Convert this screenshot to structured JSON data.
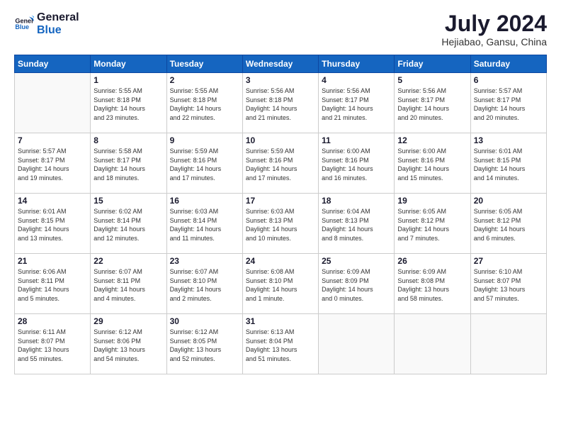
{
  "logo": {
    "line1": "General",
    "line2": "Blue"
  },
  "title": "July 2024",
  "subtitle": "Hejiabao, Gansu, China",
  "weekdays": [
    "Sunday",
    "Monday",
    "Tuesday",
    "Wednesday",
    "Thursday",
    "Friday",
    "Saturday"
  ],
  "weeks": [
    [
      {
        "day": "",
        "info": ""
      },
      {
        "day": "1",
        "info": "Sunrise: 5:55 AM\nSunset: 8:18 PM\nDaylight: 14 hours\nand 23 minutes."
      },
      {
        "day": "2",
        "info": "Sunrise: 5:55 AM\nSunset: 8:18 PM\nDaylight: 14 hours\nand 22 minutes."
      },
      {
        "day": "3",
        "info": "Sunrise: 5:56 AM\nSunset: 8:18 PM\nDaylight: 14 hours\nand 21 minutes."
      },
      {
        "day": "4",
        "info": "Sunrise: 5:56 AM\nSunset: 8:17 PM\nDaylight: 14 hours\nand 21 minutes."
      },
      {
        "day": "5",
        "info": "Sunrise: 5:56 AM\nSunset: 8:17 PM\nDaylight: 14 hours\nand 20 minutes."
      },
      {
        "day": "6",
        "info": "Sunrise: 5:57 AM\nSunset: 8:17 PM\nDaylight: 14 hours\nand 20 minutes."
      }
    ],
    [
      {
        "day": "7",
        "info": "Sunrise: 5:57 AM\nSunset: 8:17 PM\nDaylight: 14 hours\nand 19 minutes."
      },
      {
        "day": "8",
        "info": "Sunrise: 5:58 AM\nSunset: 8:17 PM\nDaylight: 14 hours\nand 18 minutes."
      },
      {
        "day": "9",
        "info": "Sunrise: 5:59 AM\nSunset: 8:16 PM\nDaylight: 14 hours\nand 17 minutes."
      },
      {
        "day": "10",
        "info": "Sunrise: 5:59 AM\nSunset: 8:16 PM\nDaylight: 14 hours\nand 17 minutes."
      },
      {
        "day": "11",
        "info": "Sunrise: 6:00 AM\nSunset: 8:16 PM\nDaylight: 14 hours\nand 16 minutes."
      },
      {
        "day": "12",
        "info": "Sunrise: 6:00 AM\nSunset: 8:16 PM\nDaylight: 14 hours\nand 15 minutes."
      },
      {
        "day": "13",
        "info": "Sunrise: 6:01 AM\nSunset: 8:15 PM\nDaylight: 14 hours\nand 14 minutes."
      }
    ],
    [
      {
        "day": "14",
        "info": "Sunrise: 6:01 AM\nSunset: 8:15 PM\nDaylight: 14 hours\nand 13 minutes."
      },
      {
        "day": "15",
        "info": "Sunrise: 6:02 AM\nSunset: 8:14 PM\nDaylight: 14 hours\nand 12 minutes."
      },
      {
        "day": "16",
        "info": "Sunrise: 6:03 AM\nSunset: 8:14 PM\nDaylight: 14 hours\nand 11 minutes."
      },
      {
        "day": "17",
        "info": "Sunrise: 6:03 AM\nSunset: 8:13 PM\nDaylight: 14 hours\nand 10 minutes."
      },
      {
        "day": "18",
        "info": "Sunrise: 6:04 AM\nSunset: 8:13 PM\nDaylight: 14 hours\nand 8 minutes."
      },
      {
        "day": "19",
        "info": "Sunrise: 6:05 AM\nSunset: 8:12 PM\nDaylight: 14 hours\nand 7 minutes."
      },
      {
        "day": "20",
        "info": "Sunrise: 6:05 AM\nSunset: 8:12 PM\nDaylight: 14 hours\nand 6 minutes."
      }
    ],
    [
      {
        "day": "21",
        "info": "Sunrise: 6:06 AM\nSunset: 8:11 PM\nDaylight: 14 hours\nand 5 minutes."
      },
      {
        "day": "22",
        "info": "Sunrise: 6:07 AM\nSunset: 8:11 PM\nDaylight: 14 hours\nand 4 minutes."
      },
      {
        "day": "23",
        "info": "Sunrise: 6:07 AM\nSunset: 8:10 PM\nDaylight: 14 hours\nand 2 minutes."
      },
      {
        "day": "24",
        "info": "Sunrise: 6:08 AM\nSunset: 8:10 PM\nDaylight: 14 hours\nand 1 minute."
      },
      {
        "day": "25",
        "info": "Sunrise: 6:09 AM\nSunset: 8:09 PM\nDaylight: 14 hours\nand 0 minutes."
      },
      {
        "day": "26",
        "info": "Sunrise: 6:09 AM\nSunset: 8:08 PM\nDaylight: 13 hours\nand 58 minutes."
      },
      {
        "day": "27",
        "info": "Sunrise: 6:10 AM\nSunset: 8:07 PM\nDaylight: 13 hours\nand 57 minutes."
      }
    ],
    [
      {
        "day": "28",
        "info": "Sunrise: 6:11 AM\nSunset: 8:07 PM\nDaylight: 13 hours\nand 55 minutes."
      },
      {
        "day": "29",
        "info": "Sunrise: 6:12 AM\nSunset: 8:06 PM\nDaylight: 13 hours\nand 54 minutes."
      },
      {
        "day": "30",
        "info": "Sunrise: 6:12 AM\nSunset: 8:05 PM\nDaylight: 13 hours\nand 52 minutes."
      },
      {
        "day": "31",
        "info": "Sunrise: 6:13 AM\nSunset: 8:04 PM\nDaylight: 13 hours\nand 51 minutes."
      },
      {
        "day": "",
        "info": ""
      },
      {
        "day": "",
        "info": ""
      },
      {
        "day": "",
        "info": ""
      }
    ]
  ]
}
